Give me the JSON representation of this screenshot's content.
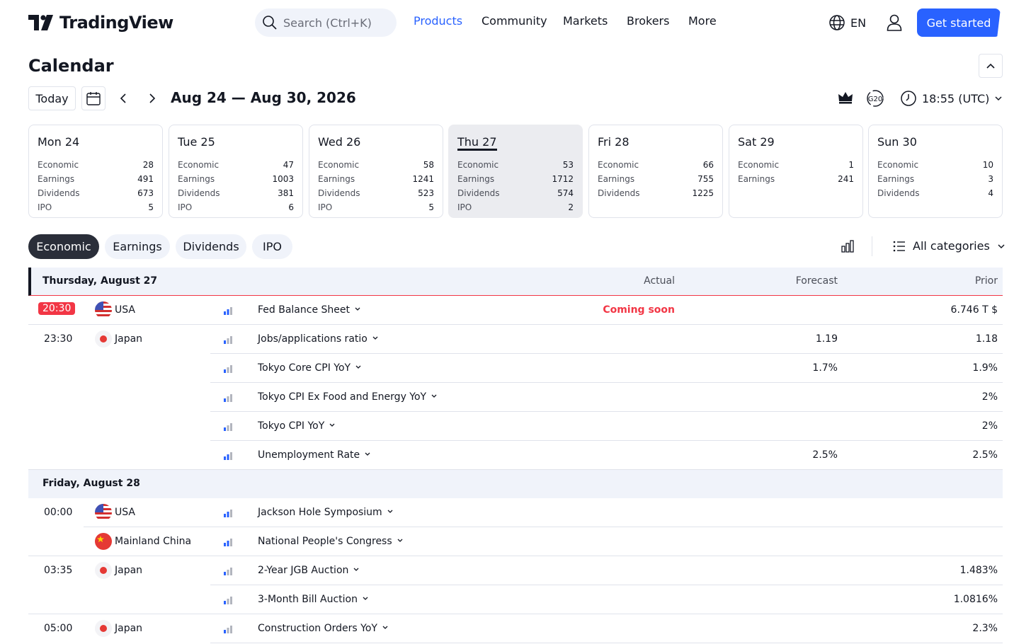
{
  "header": {
    "logo_text": "TradingView",
    "search_placeholder": "Search (Ctrl+K)",
    "nav": [
      "Products",
      "Community",
      "Markets",
      "Brokers",
      "More"
    ],
    "lang": "EN",
    "cta": "Get started",
    "accent": "#2962ff"
  },
  "calendar": {
    "title": "Calendar",
    "today_label": "Today",
    "range": "Aug 24 — Aug 30, 2026",
    "timezone": "18:55 (UTC)"
  },
  "days": [
    {
      "label": "Mon 24",
      "rows": [
        {
          "k": "Economic",
          "v": "28"
        },
        {
          "k": "Earnings",
          "v": "491"
        },
        {
          "k": "Dividends",
          "v": "673"
        },
        {
          "k": "IPO",
          "v": "5"
        }
      ]
    },
    {
      "label": "Tue 25",
      "rows": [
        {
          "k": "Economic",
          "v": "47"
        },
        {
          "k": "Earnings",
          "v": "1003"
        },
        {
          "k": "Dividends",
          "v": "381"
        },
        {
          "k": "IPO",
          "v": "6"
        }
      ]
    },
    {
      "label": "Wed 26",
      "rows": [
        {
          "k": "Economic",
          "v": "58"
        },
        {
          "k": "Earnings",
          "v": "1241"
        },
        {
          "k": "Dividends",
          "v": "523"
        },
        {
          "k": "IPO",
          "v": "5"
        }
      ]
    },
    {
      "label": "Thu 27",
      "rows": [
        {
          "k": "Economic",
          "v": "53"
        },
        {
          "k": "Earnings",
          "v": "1712"
        },
        {
          "k": "Dividends",
          "v": "574"
        },
        {
          "k": "IPO",
          "v": "2"
        }
      ]
    },
    {
      "label": "Fri 28",
      "rows": [
        {
          "k": "Economic",
          "v": "66"
        },
        {
          "k": "Earnings",
          "v": "755"
        },
        {
          "k": "Dividends",
          "v": "1225"
        }
      ]
    },
    {
      "label": "Sat 29",
      "rows": [
        {
          "k": "Economic",
          "v": "1"
        },
        {
          "k": "Earnings",
          "v": "241"
        }
      ]
    },
    {
      "label": "Sun 30",
      "rows": [
        {
          "k": "Economic",
          "v": "10"
        },
        {
          "k": "Earnings",
          "v": "3"
        },
        {
          "k": "Dividends",
          "v": "4"
        }
      ]
    }
  ],
  "selected_day": "Thu 27",
  "tabs": [
    "Economic",
    "Earnings",
    "Dividends",
    "IPO"
  ],
  "category_filter": "All categories",
  "table": {
    "columns": {
      "actual": "Actual",
      "forecast": "Forecast",
      "prior": "Prior"
    },
    "groups": [
      {
        "date": "Thursday, August 27",
        "rows": [
          {
            "time": "20:30",
            "highlight": true,
            "country": "USA",
            "flag": "us",
            "event": "Fed Balance Sheet",
            "actual": "Coming soon",
            "forecast": "",
            "prior": "6.746 T $"
          },
          {
            "time": "23:30",
            "country": "Japan",
            "flag": "jp",
            "event": "Jobs/applications ratio",
            "actual": "",
            "forecast": "1.19",
            "prior": "1.18"
          },
          {
            "time": "",
            "country": "",
            "flag": "",
            "event": "Tokyo Core CPI YoY",
            "actual": "",
            "forecast": "1.7%",
            "prior": "1.9%"
          },
          {
            "time": "",
            "country": "",
            "flag": "",
            "event": "Tokyo CPI Ex Food and Energy YoY",
            "actual": "",
            "forecast": "",
            "prior": "2%"
          },
          {
            "time": "",
            "country": "",
            "flag": "",
            "event": "Tokyo CPI YoY",
            "actual": "",
            "forecast": "",
            "prior": "2%"
          },
          {
            "time": "",
            "country": "",
            "flag": "",
            "event": "Unemployment Rate",
            "actual": "",
            "forecast": "2.5%",
            "prior": "2.5%"
          }
        ]
      },
      {
        "date": "Friday, August 28",
        "rows": [
          {
            "time": "00:00",
            "country": "USA",
            "flag": "us",
            "event": "Jackson Hole Symposium",
            "actual": "",
            "forecast": "",
            "prior": ""
          },
          {
            "time": "",
            "country": "Mainland China",
            "flag": "cn",
            "event": "National People's Congress",
            "actual": "",
            "forecast": "",
            "prior": ""
          },
          {
            "time": "03:35",
            "country": "Japan",
            "flag": "jp",
            "event": "2-Year JGB Auction",
            "actual": "",
            "forecast": "",
            "prior": "1.483%"
          },
          {
            "time": "",
            "country": "",
            "flag": "",
            "event": "3-Month Bill Auction",
            "actual": "",
            "forecast": "",
            "prior": "1.0816%"
          },
          {
            "time": "05:00",
            "country": "Japan",
            "flag": "jp",
            "event": "Construction Orders YoY",
            "actual": "",
            "forecast": "",
            "prior": "2.3%"
          }
        ]
      }
    ]
  }
}
